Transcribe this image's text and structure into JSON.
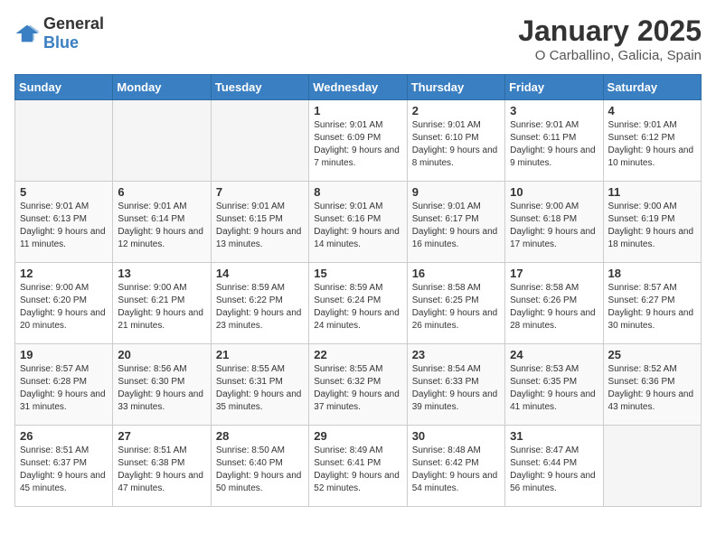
{
  "header": {
    "logo_general": "General",
    "logo_blue": "Blue",
    "title": "January 2025",
    "location": "O Carballino, Galicia, Spain"
  },
  "days_of_week": [
    "Sunday",
    "Monday",
    "Tuesday",
    "Wednesday",
    "Thursday",
    "Friday",
    "Saturday"
  ],
  "weeks": [
    [
      {
        "day": "",
        "info": ""
      },
      {
        "day": "",
        "info": ""
      },
      {
        "day": "",
        "info": ""
      },
      {
        "day": "1",
        "info": "Sunrise: 9:01 AM\nSunset: 6:09 PM\nDaylight: 9 hours and 7 minutes."
      },
      {
        "day": "2",
        "info": "Sunrise: 9:01 AM\nSunset: 6:10 PM\nDaylight: 9 hours and 8 minutes."
      },
      {
        "day": "3",
        "info": "Sunrise: 9:01 AM\nSunset: 6:11 PM\nDaylight: 9 hours and 9 minutes."
      },
      {
        "day": "4",
        "info": "Sunrise: 9:01 AM\nSunset: 6:12 PM\nDaylight: 9 hours and 10 minutes."
      }
    ],
    [
      {
        "day": "5",
        "info": "Sunrise: 9:01 AM\nSunset: 6:13 PM\nDaylight: 9 hours and 11 minutes."
      },
      {
        "day": "6",
        "info": "Sunrise: 9:01 AM\nSunset: 6:14 PM\nDaylight: 9 hours and 12 minutes."
      },
      {
        "day": "7",
        "info": "Sunrise: 9:01 AM\nSunset: 6:15 PM\nDaylight: 9 hours and 13 minutes."
      },
      {
        "day": "8",
        "info": "Sunrise: 9:01 AM\nSunset: 6:16 PM\nDaylight: 9 hours and 14 minutes."
      },
      {
        "day": "9",
        "info": "Sunrise: 9:01 AM\nSunset: 6:17 PM\nDaylight: 9 hours and 16 minutes."
      },
      {
        "day": "10",
        "info": "Sunrise: 9:00 AM\nSunset: 6:18 PM\nDaylight: 9 hours and 17 minutes."
      },
      {
        "day": "11",
        "info": "Sunrise: 9:00 AM\nSunset: 6:19 PM\nDaylight: 9 hours and 18 minutes."
      }
    ],
    [
      {
        "day": "12",
        "info": "Sunrise: 9:00 AM\nSunset: 6:20 PM\nDaylight: 9 hours and 20 minutes."
      },
      {
        "day": "13",
        "info": "Sunrise: 9:00 AM\nSunset: 6:21 PM\nDaylight: 9 hours and 21 minutes."
      },
      {
        "day": "14",
        "info": "Sunrise: 8:59 AM\nSunset: 6:22 PM\nDaylight: 9 hours and 23 minutes."
      },
      {
        "day": "15",
        "info": "Sunrise: 8:59 AM\nSunset: 6:24 PM\nDaylight: 9 hours and 24 minutes."
      },
      {
        "day": "16",
        "info": "Sunrise: 8:58 AM\nSunset: 6:25 PM\nDaylight: 9 hours and 26 minutes."
      },
      {
        "day": "17",
        "info": "Sunrise: 8:58 AM\nSunset: 6:26 PM\nDaylight: 9 hours and 28 minutes."
      },
      {
        "day": "18",
        "info": "Sunrise: 8:57 AM\nSunset: 6:27 PM\nDaylight: 9 hours and 30 minutes."
      }
    ],
    [
      {
        "day": "19",
        "info": "Sunrise: 8:57 AM\nSunset: 6:28 PM\nDaylight: 9 hours and 31 minutes."
      },
      {
        "day": "20",
        "info": "Sunrise: 8:56 AM\nSunset: 6:30 PM\nDaylight: 9 hours and 33 minutes."
      },
      {
        "day": "21",
        "info": "Sunrise: 8:55 AM\nSunset: 6:31 PM\nDaylight: 9 hours and 35 minutes."
      },
      {
        "day": "22",
        "info": "Sunrise: 8:55 AM\nSunset: 6:32 PM\nDaylight: 9 hours and 37 minutes."
      },
      {
        "day": "23",
        "info": "Sunrise: 8:54 AM\nSunset: 6:33 PM\nDaylight: 9 hours and 39 minutes."
      },
      {
        "day": "24",
        "info": "Sunrise: 8:53 AM\nSunset: 6:35 PM\nDaylight: 9 hours and 41 minutes."
      },
      {
        "day": "25",
        "info": "Sunrise: 8:52 AM\nSunset: 6:36 PM\nDaylight: 9 hours and 43 minutes."
      }
    ],
    [
      {
        "day": "26",
        "info": "Sunrise: 8:51 AM\nSunset: 6:37 PM\nDaylight: 9 hours and 45 minutes."
      },
      {
        "day": "27",
        "info": "Sunrise: 8:51 AM\nSunset: 6:38 PM\nDaylight: 9 hours and 47 minutes."
      },
      {
        "day": "28",
        "info": "Sunrise: 8:50 AM\nSunset: 6:40 PM\nDaylight: 9 hours and 50 minutes."
      },
      {
        "day": "29",
        "info": "Sunrise: 8:49 AM\nSunset: 6:41 PM\nDaylight: 9 hours and 52 minutes."
      },
      {
        "day": "30",
        "info": "Sunrise: 8:48 AM\nSunset: 6:42 PM\nDaylight: 9 hours and 54 minutes."
      },
      {
        "day": "31",
        "info": "Sunrise: 8:47 AM\nSunset: 6:44 PM\nDaylight: 9 hours and 56 minutes."
      },
      {
        "day": "",
        "info": ""
      }
    ]
  ]
}
